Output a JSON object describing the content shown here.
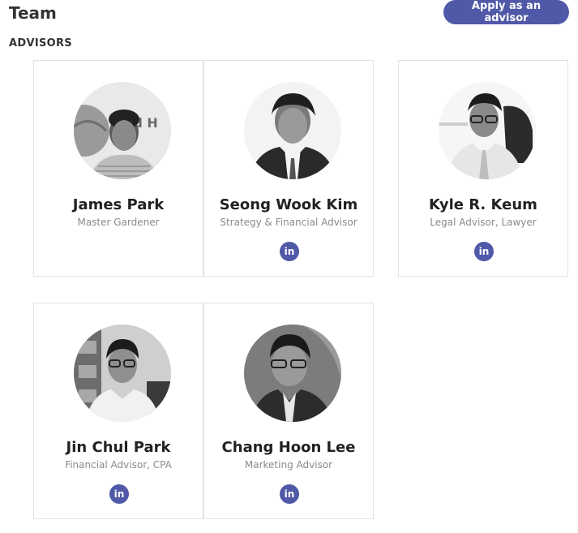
{
  "header": {
    "title": "Team",
    "apply_label": "Apply as an advisor"
  },
  "section": {
    "label": "ADVISORS"
  },
  "advisors": [
    {
      "name": "James Park",
      "role": "Master Gardener",
      "linkedin": false
    },
    {
      "name": "Seong Wook Kim",
      "role": "Strategy & Financial Advisor",
      "linkedin": true,
      "linkedin_label": "in"
    },
    {
      "name": "Kyle R. Keum",
      "role": "Legal Advisor, Lawyer",
      "linkedin": true,
      "linkedin_label": "in"
    },
    {
      "name": "Jin Chul Park",
      "role": "Financial Advisor, CPA",
      "linkedin": true,
      "linkedin_label": "in"
    },
    {
      "name": "Chang Hoon Lee",
      "role": "Marketing Advisor",
      "linkedin": true,
      "linkedin_label": "in"
    }
  ],
  "colors": {
    "accent": "#5058a8",
    "card_border": "#e2e2e2",
    "role_text": "#8a8a8a"
  },
  "icons": {
    "linkedin": "linkedin-icon"
  }
}
